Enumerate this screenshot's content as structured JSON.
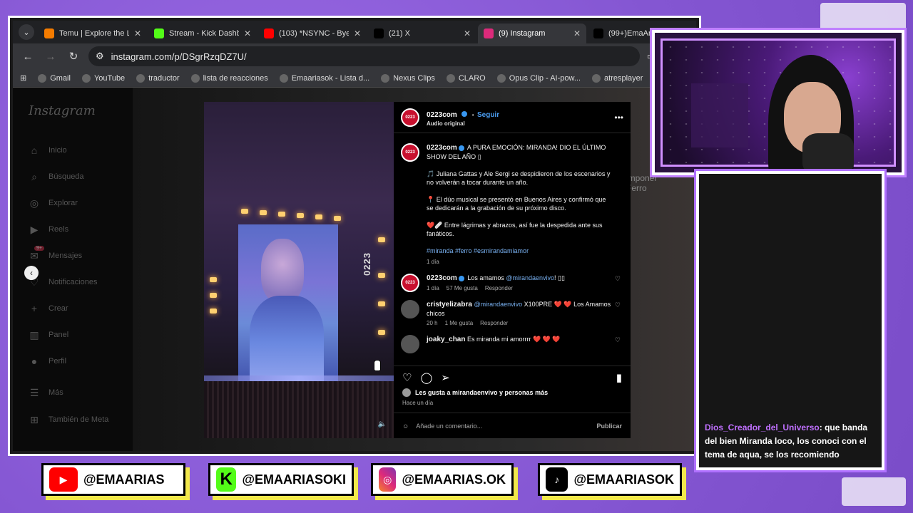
{
  "browser": {
    "tabs": [
      {
        "title": "Temu | Explore the La",
        "icon": "temu-icon",
        "color": "#f57c00",
        "active": false
      },
      {
        "title": "Stream - Kick Dashbo",
        "icon": "kick-icon",
        "color": "#53fc18",
        "active": false
      },
      {
        "title": "(103) *NSYNC - Bye B",
        "icon": "youtube-icon",
        "color": "#ff0000",
        "active": false
      },
      {
        "title": "(21) X",
        "icon": "x-icon",
        "color": "#000000",
        "active": false
      },
      {
        "title": "(9) Instagram",
        "icon": "instagram-icon",
        "color": "#dd2a7b",
        "active": true
      },
      {
        "title": "(99+)EmaArias",
        "icon": "tiktok-icon",
        "color": "#000000",
        "active": false
      }
    ],
    "url": "instagram.com/p/DSgrRzqDZ7U/",
    "bookmarks": [
      "Gmail",
      "YouTube",
      "traductor",
      "lista de reacciones",
      "Emaariasok - Lista d...",
      "Nexus Clips",
      "CLARO",
      "Opus Clip - AI-pow...",
      "atresplayer"
    ]
  },
  "instagram": {
    "logo": "Instagram",
    "nav": [
      {
        "label": "Inicio",
        "icon": "home-icon",
        "glyph": "⌂"
      },
      {
        "label": "Búsqueda",
        "icon": "search-icon",
        "glyph": "⌕"
      },
      {
        "label": "Explorar",
        "icon": "compass-icon",
        "glyph": "◎"
      },
      {
        "label": "Reels",
        "icon": "reels-icon",
        "glyph": "▶"
      },
      {
        "label": "Mensajes",
        "icon": "messages-icon",
        "glyph": "✉",
        "badge": "9+"
      },
      {
        "label": "Notificaciones",
        "icon": "heart-icon",
        "glyph": "♡"
      },
      {
        "label": "Crear",
        "icon": "plus-icon",
        "glyph": "+"
      },
      {
        "label": "Panel",
        "icon": "dashboard-icon",
        "glyph": "▥"
      },
      {
        "label": "Perfil",
        "icon": "profile-icon",
        "glyph": "●"
      }
    ],
    "more": "Más",
    "meta": "También de Meta",
    "video_watermark": "0223",
    "bg_text": "imponer\nFerro"
  },
  "post": {
    "author": "0223com",
    "avatar_text": "0223",
    "follow": "Seguir",
    "audio": "Audio original",
    "caption_title": "A PURA EMOCIÓN: MIRANDA! DIO EL ÚLTIMO SHOW DEL AÑO ▯",
    "caption_p1": "🎵 Juliana Gattas y Ale Sergi se despidieron de los escenarios y no volverán a tocar durante un año.",
    "caption_p2": "📍 El dúo musical se presentó en Buenos Aires y confirmó que se dedicarán a la grabación de su próximo disco.",
    "caption_p3": "❤️🩹 Entre lágrimas y abrazos, así fue la despedida ante sus fanáticos.",
    "hashtags": "#miranda #ferro #esmirandamiamor",
    "caption_time": "1 día",
    "comments": [
      {
        "user": "0223com",
        "verified": true,
        "mention": "@mirandaenvivo",
        "pre": "Los amamos ",
        "text": "! ▯▯",
        "time": "1 día",
        "likes": "57 Me gusta",
        "reply": "Responder"
      },
      {
        "user": "cristyelizabra",
        "verified": false,
        "mention": "@mirandaenvivo",
        "pre": "",
        "text": " X100PRE ❤️ ❤️ Los Amamos chicos",
        "time": "20 h",
        "likes": "1 Me gusta",
        "reply": "Responder"
      },
      {
        "user": "joaky_chan",
        "verified": false,
        "mention": "",
        "pre": "",
        "text": "Es miranda mi amorrrr ❤️ ❤️ ❤️",
        "time": "",
        "likes": "",
        "reply": ""
      }
    ],
    "liked_by": "Les gusta a mirandaenvivo y personas más",
    "posted": "Hace un día",
    "comment_placeholder": "Añade un comentario...",
    "publish": "Publicar"
  },
  "chat": {
    "user": "Dios_Creador_del_Universo",
    "message": ": que banda del bien Miranda loco, los conoci con el tema de aqua, se los recomiendo"
  },
  "socials": [
    {
      "handle": "@EMAARIAS",
      "icon": "youtube-icon",
      "glyph": "▶"
    },
    {
      "handle": "@EMAARIASOKI",
      "icon": "kick-icon",
      "glyph": "K"
    },
    {
      "handle": "@EMAARIAS.OK",
      "icon": "instagram-icon",
      "glyph": "◎"
    },
    {
      "handle": "@EMAARIASOK",
      "icon": "tiktok-icon",
      "glyph": "♪",
      "sub": "TikTok"
    }
  ]
}
